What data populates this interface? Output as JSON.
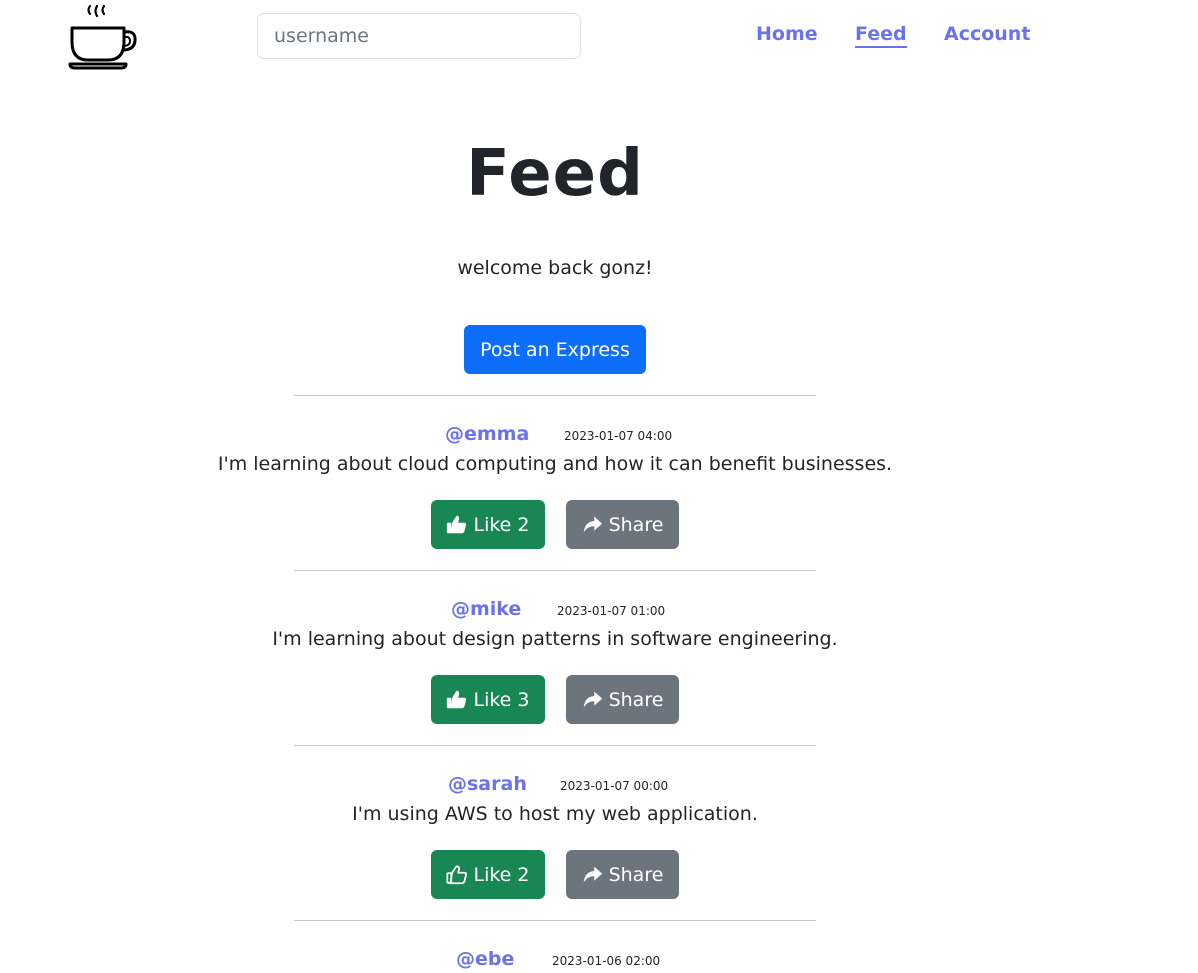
{
  "header": {
    "search": {
      "placeholder": "username",
      "value": ""
    },
    "nav": [
      {
        "label": "Home",
        "active": false
      },
      {
        "label": "Feed",
        "active": true
      },
      {
        "label": "Account",
        "active": false
      }
    ]
  },
  "page": {
    "title": "Feed",
    "welcome": "welcome back gonz!",
    "post_button": "Post an Express"
  },
  "posts": [
    {
      "user": "@emma",
      "time": "2023-01-07 04:00",
      "text": "I'm learning about cloud computing and how it can benefit businesses.",
      "like_label": "Like 2",
      "share_label": "Share",
      "liked": true
    },
    {
      "user": "@mike",
      "time": "2023-01-07 01:00",
      "text": "I'm learning about design patterns in software engineering.",
      "like_label": "Like 3",
      "share_label": "Share",
      "liked": true
    },
    {
      "user": "@sarah",
      "time": "2023-01-07 00:00",
      "text": "I'm using AWS to host my web application.",
      "like_label": "Like 2",
      "share_label": "Share",
      "liked": false
    },
    {
      "user": "@ebe",
      "time": "2023-01-06 02:00",
      "text": "",
      "like_label": "",
      "share_label": "",
      "liked": false
    }
  ],
  "colors": {
    "link": "#6a73e8",
    "primary": "#0d6efd",
    "success": "#198754",
    "secondary": "#6c757d"
  }
}
